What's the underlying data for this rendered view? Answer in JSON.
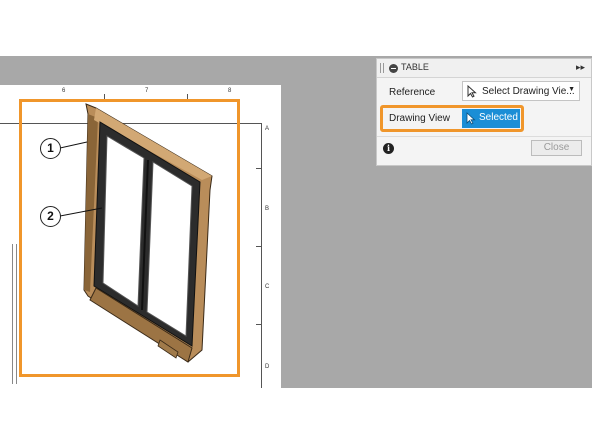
{
  "drawing": {
    "columns": [
      "6",
      "7",
      "8"
    ],
    "rows": [
      "A",
      "B",
      "C",
      "D"
    ],
    "balloons": [
      "1",
      "2"
    ]
  },
  "panel": {
    "title": "TABLE",
    "reference_label": "Reference",
    "reference_value": "Select Drawing Vie...",
    "drawing_view_label": "Drawing View",
    "drawing_view_value": "Selected",
    "close_label": "Close",
    "info_glyph": "i"
  },
  "colors": {
    "highlight": "#f0962b",
    "selected": "#1b8ed6",
    "canvas": "#a8a8a8",
    "wood": "#b98d5a"
  },
  "icons": [
    "grip-icon",
    "collapse-icon",
    "fast-forward-icon",
    "cursor-icon",
    "dropdown-caret-icon",
    "info-icon"
  ]
}
